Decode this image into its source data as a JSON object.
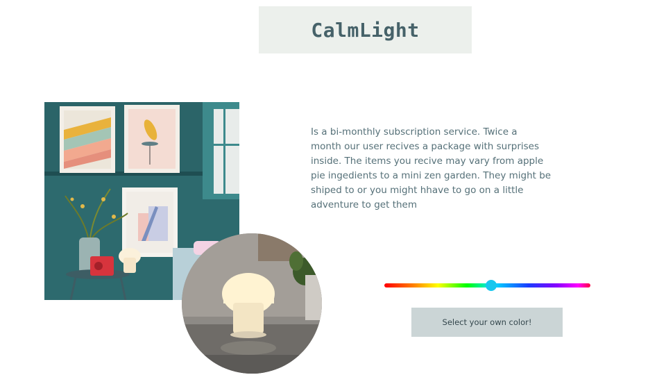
{
  "header": {
    "logo_text": "CalmLight"
  },
  "description": {
    "text": "Is a bi-monthly subscription  service. Twice a\nmonth our user recives a package with surprises\ninside.  The items you recive may vary from apple\npie ingedients to a mini zen garden. They might be\nshiped to or you might hhave to go on a little\nadventure to get them"
  },
  "color_picker": {
    "slider_value": 0.52,
    "thumb_color": "#17c7ee",
    "button_label": "Select your own color!"
  },
  "colors": {
    "logo_background": "#ecf0ec",
    "logo_text": "#466269",
    "body_text": "#557078",
    "button_background": "#cbd5d6"
  }
}
